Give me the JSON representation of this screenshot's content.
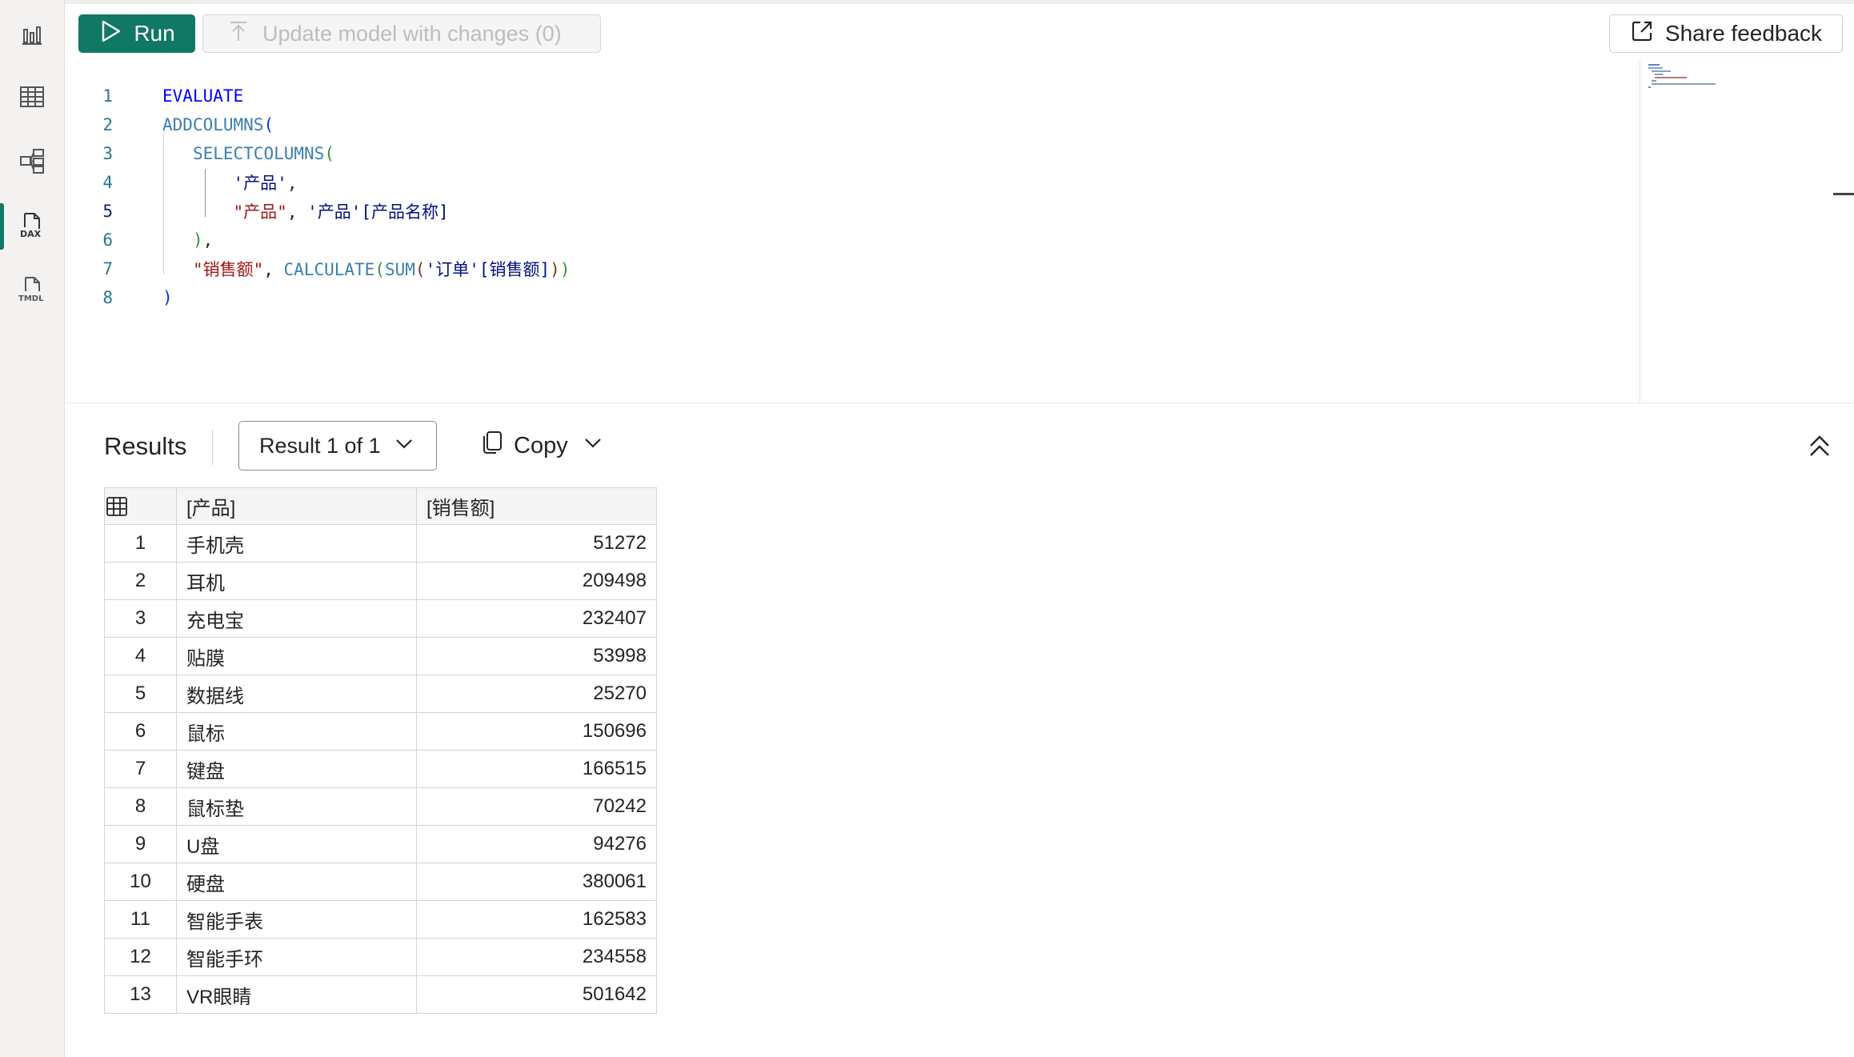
{
  "toolbar": {
    "run_label": "Run",
    "update_label": "Update model with changes (0)",
    "share_label": "Share feedback"
  },
  "rail": {
    "items": [
      {
        "name": "report-view",
        "icon": "bar-chart-icon"
      },
      {
        "name": "table-view",
        "icon": "table-icon"
      },
      {
        "name": "model-view",
        "icon": "model-icon"
      },
      {
        "name": "dax-query-view",
        "icon": "dax-icon",
        "active": true
      },
      {
        "name": "tmdl-view",
        "icon": "tmdl-icon"
      }
    ],
    "dax_label": "DAX",
    "tmdl_label": "TMDL"
  },
  "editor": {
    "current_line": 5,
    "lines": [
      {
        "n": "1",
        "text": "EVALUATE"
      },
      {
        "n": "2",
        "text": "ADDCOLUMNS("
      },
      {
        "n": "3",
        "text": "    SELECTCOLUMNS("
      },
      {
        "n": "4",
        "text": "        '产品',"
      },
      {
        "n": "5",
        "text": "        \"产品\", '产品'[产品名称]"
      },
      {
        "n": "6",
        "text": "    ),"
      },
      {
        "n": "7",
        "text": "    \"销售额\", CALCULATE(SUM('订单'[销售额]))"
      },
      {
        "n": "8",
        "text": ")"
      }
    ],
    "tokens": {
      "evaluate": "EVALUATE",
      "addcolumns": "ADDCOLUMNS",
      "selectcolumns": "SELECTCOLUMNS",
      "calculate": "CALCULATE",
      "sum": "SUM",
      "table_product": "'产品'",
      "str_product": "\"产品\"",
      "col_product_name": "[产品名称]",
      "str_sales": "\"销售额\"",
      "table_order": "'订单'",
      "col_sales": "[销售额]"
    }
  },
  "results": {
    "title": "Results",
    "result_selector": "Result 1 of 1",
    "copy_label": "Copy",
    "columns": [
      "[产品]",
      "[销售额]"
    ],
    "rows": [
      {
        "idx": "1",
        "name": "手机壳",
        "value": "51272"
      },
      {
        "idx": "2",
        "name": "耳机",
        "value": "209498"
      },
      {
        "idx": "3",
        "name": "充电宝",
        "value": "232407"
      },
      {
        "idx": "4",
        "name": "贴膜",
        "value": "53998"
      },
      {
        "idx": "5",
        "name": "数据线",
        "value": "25270"
      },
      {
        "idx": "6",
        "name": "鼠标",
        "value": "150696"
      },
      {
        "idx": "7",
        "name": "键盘",
        "value": "166515"
      },
      {
        "idx": "8",
        "name": "鼠标垫",
        "value": "70242"
      },
      {
        "idx": "9",
        "name": "U盘",
        "value": "94276"
      },
      {
        "idx": "10",
        "name": "硬盘",
        "value": "380061"
      },
      {
        "idx": "11",
        "name": "智能手表",
        "value": "162583"
      },
      {
        "idx": "12",
        "name": "智能手环",
        "value": "234558"
      },
      {
        "idx": "13",
        "name": "VR眼睛",
        "value": "501642"
      }
    ]
  },
  "colors": {
    "accent": "#117865",
    "keyword": "#0000ff",
    "function": "#3a7fb0",
    "string": "#a31515"
  }
}
